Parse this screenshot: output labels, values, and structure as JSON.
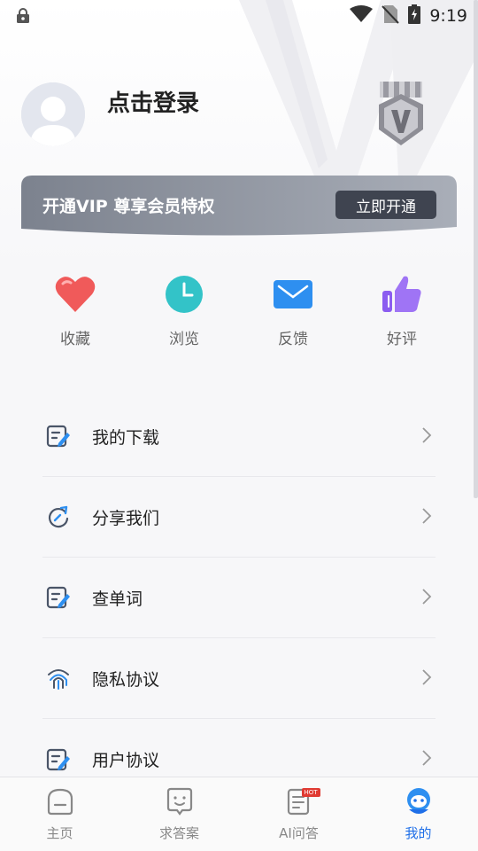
{
  "status_bar": {
    "time": "9:19"
  },
  "profile": {
    "login_label": "点击登录"
  },
  "vip_banner": {
    "text": "开通VIP 尊享会员特权",
    "button_label": "立即开通"
  },
  "quick_actions": [
    {
      "label": "收藏",
      "icon": "heart-icon",
      "color": "#f05a5a"
    },
    {
      "label": "浏览",
      "icon": "clock-icon",
      "color": "#33c3c8"
    },
    {
      "label": "反馈",
      "icon": "mail-icon",
      "color": "#2e8ff0"
    },
    {
      "label": "好评",
      "icon": "thumbs-up-icon",
      "color": "#8b5cf0"
    }
  ],
  "menu": [
    {
      "label": "我的下载",
      "icon": "edit-note-icon"
    },
    {
      "label": "分享我们",
      "icon": "share-refresh-icon"
    },
    {
      "label": "查单词",
      "icon": "edit-note-icon"
    },
    {
      "label": "隐私协议",
      "icon": "fingerprint-icon"
    },
    {
      "label": "用户协议",
      "icon": "edit-note-icon"
    }
  ],
  "tabbar": [
    {
      "label": "主页",
      "icon": "home-icon",
      "active": false
    },
    {
      "label": "求答案",
      "icon": "chat-icon",
      "active": false
    },
    {
      "label": "AI问答",
      "icon": "document-icon",
      "badge": "HOT",
      "active": false
    },
    {
      "label": "我的",
      "icon": "profile-mascot-icon",
      "active": true
    }
  ],
  "colors": {
    "accent": "#1f6fe8",
    "vip_banner": "#8a909c",
    "vip_button": "#3f4450"
  }
}
